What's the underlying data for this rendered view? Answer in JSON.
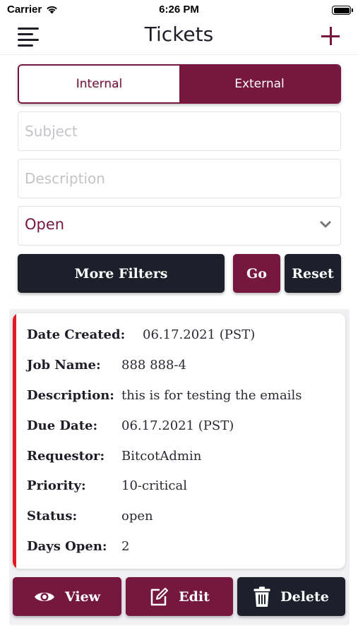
{
  "status_bar": {
    "carrier": "Carrier",
    "time": "6:26 PM"
  },
  "nav": {
    "title": "Tickets",
    "left_icon": "menu-icon",
    "right_icon": "plus-icon"
  },
  "segment": {
    "internal_label": "Internal",
    "external_label": "External",
    "selected": "External"
  },
  "filters": {
    "subject_placeholder": "Subject",
    "description_placeholder": "Description",
    "status_value": "Open"
  },
  "buttons": {
    "more_filters": "More Filters",
    "go": "Go",
    "reset": "Reset"
  },
  "ticket": {
    "rows": [
      {
        "label": "Date Created:",
        "value": "06.17.2021 (PST)"
      },
      {
        "label": "Job Name:",
        "value": "888 888-4"
      },
      {
        "label": "Description:",
        "value": "this is for testing the emails"
      },
      {
        "label": "Due Date:",
        "value": "06.17.2021 (PST)"
      },
      {
        "label": "Requestor:",
        "value": "BitcotAdmin"
      },
      {
        "label": "Priority:",
        "value": "10-critical"
      },
      {
        "label": "Status:",
        "value": "open"
      },
      {
        "label": "Days Open:",
        "value": "2"
      }
    ]
  },
  "actions": {
    "view": "View",
    "edit": "Edit",
    "delete": "Delete"
  },
  "colors": {
    "accent": "#75173f",
    "dark": "#1d202b",
    "card_stripe": "#e21a22"
  }
}
